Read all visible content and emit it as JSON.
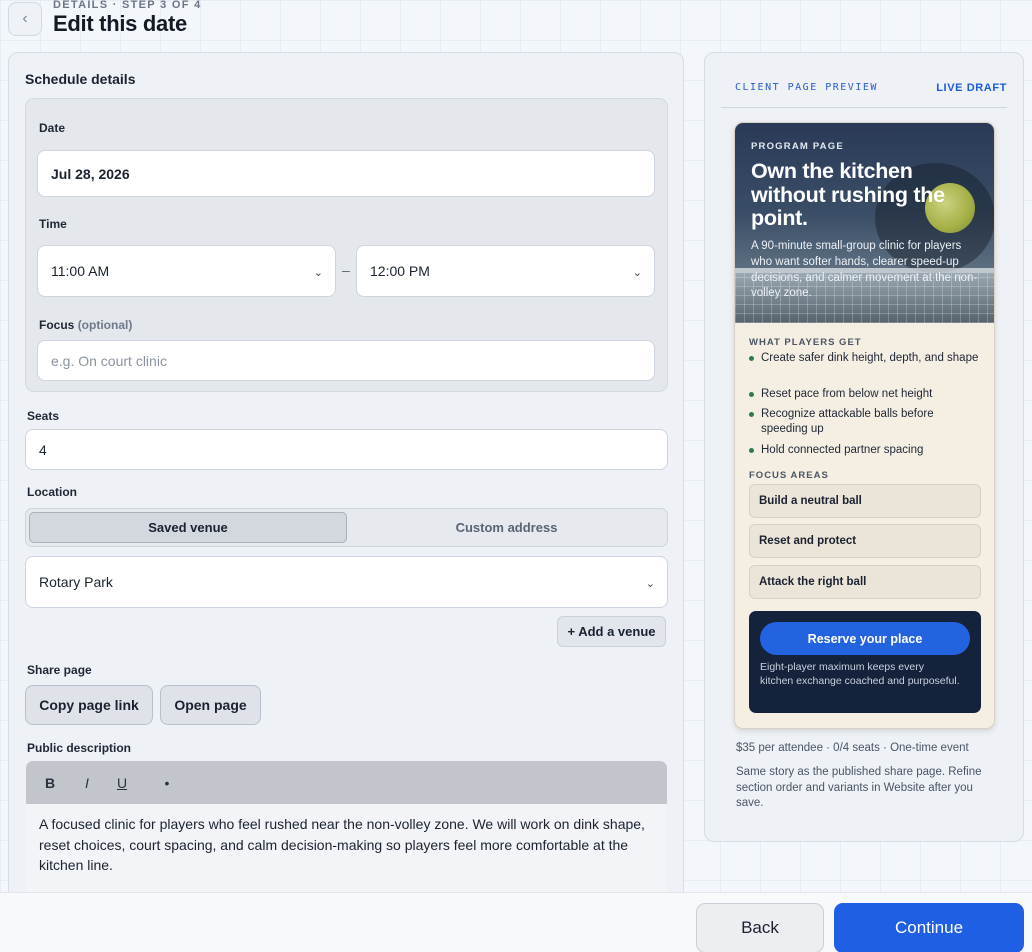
{
  "header": {
    "back_icon": "chevron-left-icon",
    "eyebrow": "DETAILS · STEP 3 OF 4",
    "title": "Edit this date"
  },
  "form": {
    "section_title": "Schedule details",
    "date": {
      "label": "Date",
      "value": "Jul 28, 2026"
    },
    "time": {
      "label": "Time",
      "start": "11:00 AM",
      "end": "12:00 PM",
      "separator": "–"
    },
    "focus": {
      "label": "Focus",
      "optional": "(optional)",
      "placeholder": "e.g. On court clinic",
      "value": ""
    },
    "seats": {
      "label": "Seats",
      "value": "4"
    },
    "location": {
      "label": "Location",
      "options": [
        "Saved venue",
        "Custom address"
      ],
      "selected": "Saved venue",
      "venue": "Rotary Park",
      "add_venue": "+ Add a venue"
    },
    "share": {
      "label": "Share page",
      "copy_link": "Copy page link",
      "open_page": "Open page"
    },
    "description": {
      "label": "Public description",
      "toolbar": {
        "bold": "B",
        "italic": "I",
        "underline": "U",
        "bullet": "•"
      },
      "text": "A focused clinic for players who feel rushed near the non-volley zone. We will work on dink shape, reset choices, court spacing, and calm decision-making so players feel more comfortable at the kitchen line."
    }
  },
  "preview": {
    "label": "CLIENT PAGE PREVIEW",
    "status": "LIVE DRAFT",
    "hero": {
      "kicker": "PROGRAM PAGE",
      "title": "Own the kitchen without rushing the point.",
      "subtitle": "A 90-minute small-group clinic for players who want softer hands, clearer speed-up decisions, and calmer movement at the non-volley zone."
    },
    "what_players_get": {
      "heading": "WHAT PLAYERS GET",
      "items": [
        "Create safer dink height, depth, and shape",
        "Reset pace from below net height",
        "Recognize attackable balls before speeding up",
        "Hold connected partner spacing"
      ]
    },
    "focus_areas": {
      "heading": "FOCUS AREAS",
      "items": [
        "Build a neutral ball",
        "Reset and protect",
        "Attack the right ball"
      ]
    },
    "cta": {
      "button": "Reserve your place",
      "note": "Eight-player maximum keeps every kitchen exchange coached and purposeful."
    },
    "price_line": "$35 per attendee · 0/4 seats · One-time event",
    "note": "Same story as the published share page. Refine section order and variants in Website after you save."
  },
  "footer": {
    "back": "Back",
    "continue": "Continue"
  },
  "colors": {
    "accent": "#1f5fe3",
    "cta_dark": "#14223b",
    "bullet_green": "#2d7a4a"
  }
}
